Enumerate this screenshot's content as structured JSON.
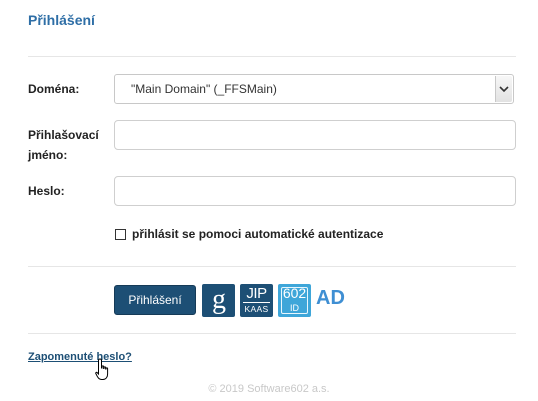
{
  "form": {
    "title": "Přihlášení",
    "domain_label": "Doména:",
    "domain_value": "\"Main Domain\" (_FFSMain)",
    "username_label_line1": "Přihlašovací",
    "username_label_line2": "jméno:",
    "username_value": "",
    "password_label": "Heslo:",
    "password_value": "",
    "auto_auth_label": "přihlásit se pomoci automatické autentizace",
    "auto_auth_checked": false
  },
  "buttons": {
    "login_label": "Přihlášení",
    "google_icon_text": "g",
    "jip_big": "JIP",
    "jip_small": "KAAS",
    "id_big": "602",
    "id_small": "ID",
    "ad_label": "AD"
  },
  "links": {
    "forgot_password": "Zapomenuté heslo?"
  },
  "footer": {
    "copyright": "© 2019 Software602 a.s."
  },
  "colors": {
    "title": "#2e6ea6",
    "primary_button": "#1d4f75",
    "id_button": "#3ea6d9",
    "ad_text": "#3f8fd3",
    "copyright": "#c8c8c8"
  }
}
